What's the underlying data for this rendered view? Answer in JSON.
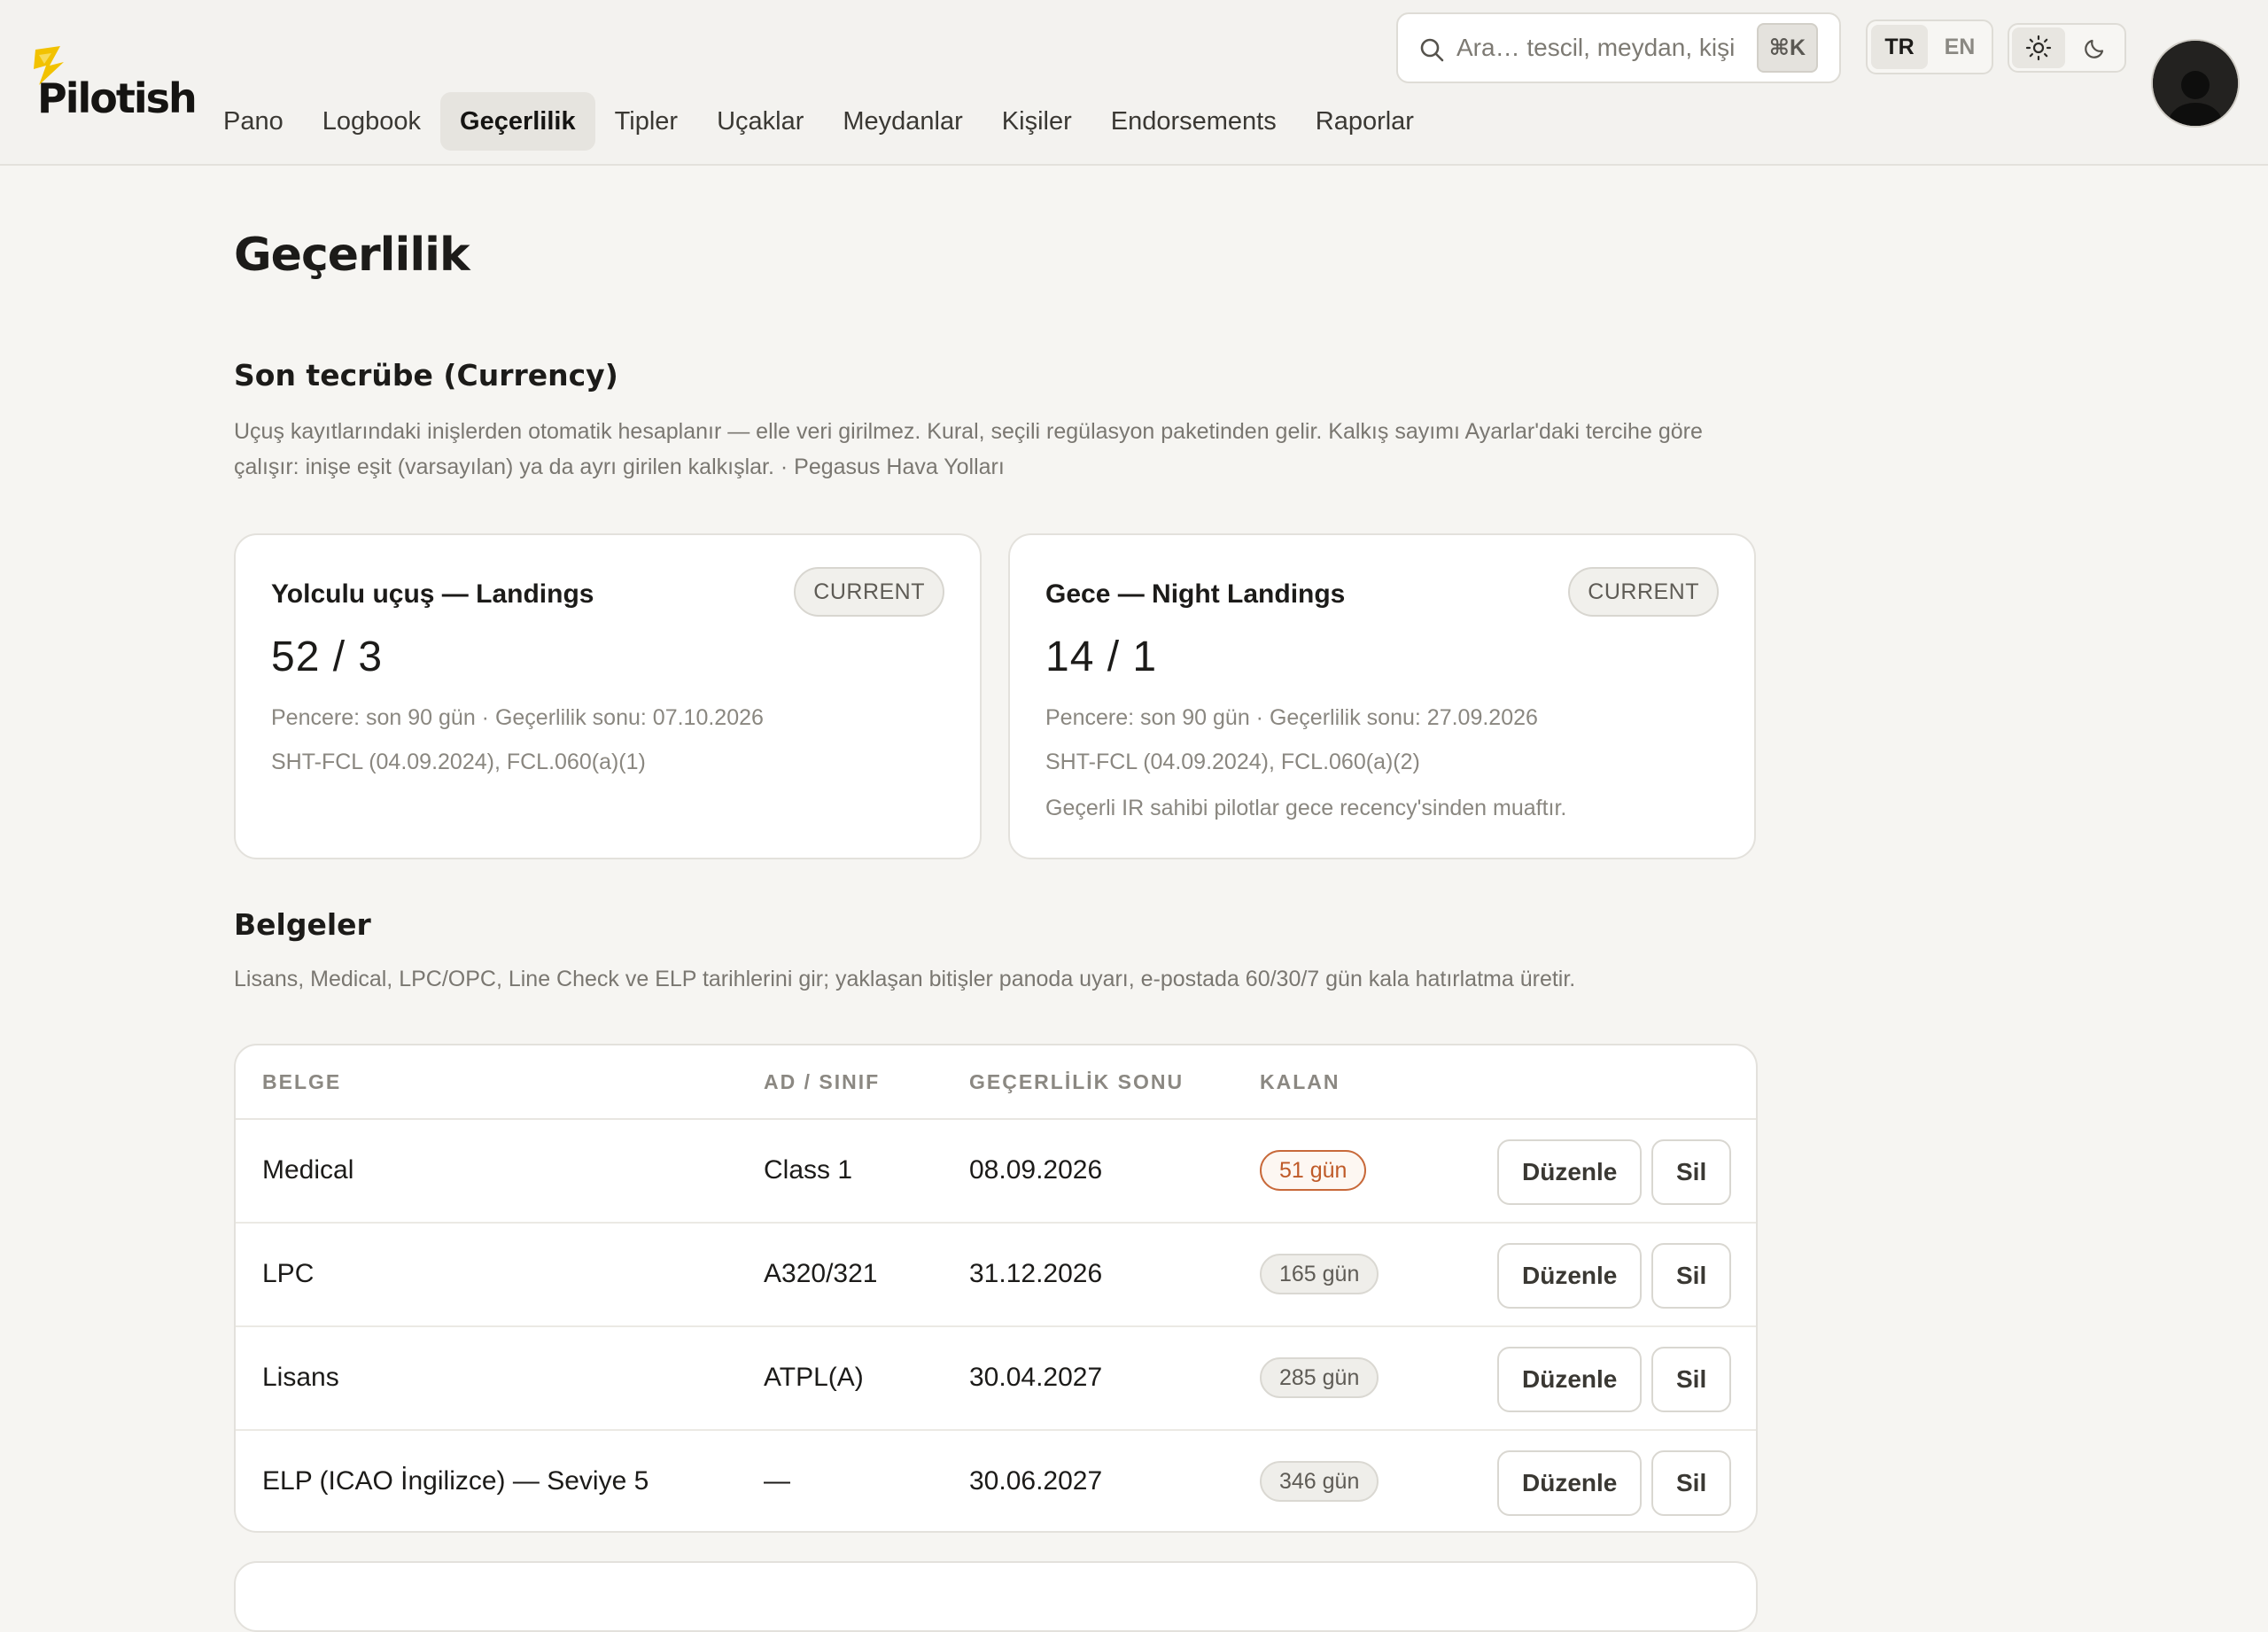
{
  "brand": {
    "name": "Pilotish",
    "accent": "#f2c200"
  },
  "nav": {
    "items": [
      {
        "label": "Pano"
      },
      {
        "label": "Logbook"
      },
      {
        "label": "Geçerlilik",
        "active": true
      },
      {
        "label": "Tipler"
      },
      {
        "label": "Uçaklar"
      },
      {
        "label": "Meydanlar"
      },
      {
        "label": "Kişiler"
      },
      {
        "label": "Endorsements"
      },
      {
        "label": "Raporlar"
      }
    ]
  },
  "search": {
    "placeholder": "Ara… tescil, meydan, kişi",
    "shortcut": "⌘K",
    "icon": "search-icon"
  },
  "language": {
    "options": [
      "TR",
      "EN"
    ],
    "selected": "TR"
  },
  "theme": {
    "options": [
      "sun-icon",
      "moon-icon"
    ],
    "selected": "sun-icon"
  },
  "page": {
    "title": "Geçerlilik"
  },
  "currency": {
    "title": "Son tecrübe (Currency)",
    "description": "Uçuş kayıtlarındaki inişlerden otomatik hesaplanır — elle veri girilmez. Kural, seçili regülasyon paketinden gelir. Kalkış sayımı Ayarlar'daki tercihe göre çalışır: inişe eşit (varsayılan) ya da ayrı girilen kalkışlar. · Pegasus Hava Yolları",
    "cards": [
      {
        "title": "Yolculu uçuş — Landings",
        "status": "CURRENT",
        "value": "52 / 3",
        "window": "Pencere: son 90 gün · Geçerlilik sonu: 07.10.2026",
        "rule": "SHT-FCL (04.09.2024), FCL.060(a)(1)",
        "note": ""
      },
      {
        "title": "Gece — Night Landings",
        "status": "CURRENT",
        "value": "14 / 1",
        "window": "Pencere: son 90 gün · Geçerlilik sonu: 27.09.2026",
        "rule": "SHT-FCL (04.09.2024), FCL.060(a)(2)",
        "note": "Geçerli IR sahibi pilotlar gece recency'sinden muaftır."
      }
    ]
  },
  "documents": {
    "title": "Belgeler",
    "description": "Lisans, Medical, LPC/OPC, Line Check ve ELP tarihlerini gir; yaklaşan bitişler panoda uyarı, e-postada 60/30/7 gün kala hatırlatma üretir.",
    "columns": [
      "BELGE",
      "AD / SINIF",
      "GEÇERLİLİK SONU",
      "KALAN"
    ],
    "edit_label": "Düzenle",
    "delete_label": "Sil",
    "rows": [
      {
        "name": "Medical",
        "class": "Class 1",
        "expiry": "08.09.2026",
        "remaining": "51 gün",
        "warning": true
      },
      {
        "name": "LPC",
        "class": "A320/321",
        "expiry": "31.12.2026",
        "remaining": "165 gün",
        "warning": false
      },
      {
        "name": "Lisans",
        "class": "ATPL(A)",
        "expiry": "30.04.2027",
        "remaining": "285 gün",
        "warning": false
      },
      {
        "name": "ELP (ICAO İngilizce) — Seviye 5",
        "class": "—",
        "expiry": "30.06.2027",
        "remaining": "346 gün",
        "warning": false
      }
    ]
  },
  "colors": {
    "warning": "#bf5a28",
    "background": "#f6f5f2",
    "card": "#ffffff"
  }
}
